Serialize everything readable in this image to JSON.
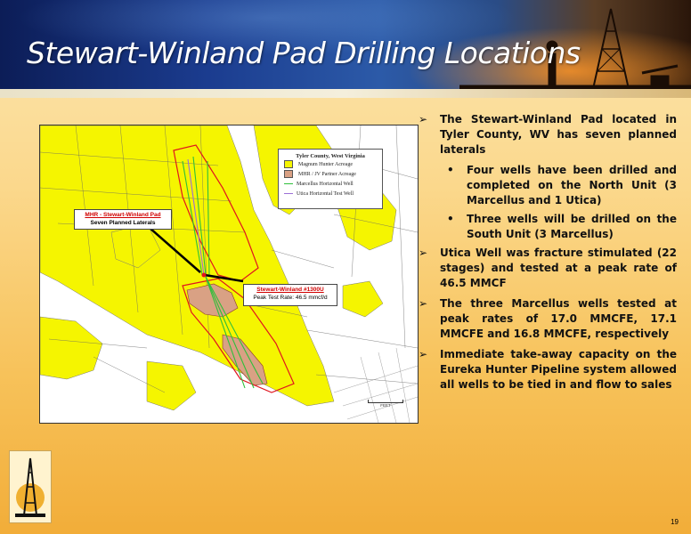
{
  "slide": {
    "title": "Stewart-Winland Pad Drilling Locations",
    "page_number": "19"
  },
  "map": {
    "legend": {
      "title": "Tyler County, West Virginia",
      "items": [
        {
          "label": "Magnum Hunter Acreage",
          "color": "#f5f500"
        },
        {
          "label": "MHR / JV Partner Acreage",
          "color": "#d9a184"
        },
        {
          "label": "Marcellus Horizontal Well",
          "color": "#2fbf3a"
        },
        {
          "label": "Utica Horizontal Test Well",
          "color": "#9b6fd6"
        }
      ]
    },
    "callout_pad": {
      "title": "MHR - Stewart-Winland Pad",
      "subtitle": "Seven Planned Laterals"
    },
    "callout_well": {
      "title": "Stewart-Winland #1300U",
      "subtitle": "Peak Test Rate: 46.5 mmcf/d"
    },
    "scale_label": "FEET"
  },
  "bullets": [
    {
      "text": "The Stewart-Winland Pad located in Tyler County, WV has seven planned laterals",
      "sub": [
        "Four wells have been drilled and completed on the North Unit (3 Marcellus and 1 Utica)",
        "Three wells will be drilled on the South Unit (3 Marcellus)"
      ]
    },
    {
      "text": "Utica Well was fracture stimulated (22 stages) and tested at a peak rate of 46.5 MMCF",
      "sub": []
    },
    {
      "text": "The three Marcellus wells tested at peak rates of 17.0 MMCFE, 17.1 MMCFE and 16.8 MMCFE, respectively",
      "sub": []
    },
    {
      "text": "Immediate take-away capacity on the Eureka Hunter Pipeline system allowed all wells to be tied in and flow to sales",
      "sub": []
    }
  ],
  "colors": {
    "acreage": "#f5f500",
    "partner": "#d9a184",
    "marcellus": "#2fbf3a",
    "utica": "#9b6fd6",
    "unit_outline": "#e0141e"
  }
}
